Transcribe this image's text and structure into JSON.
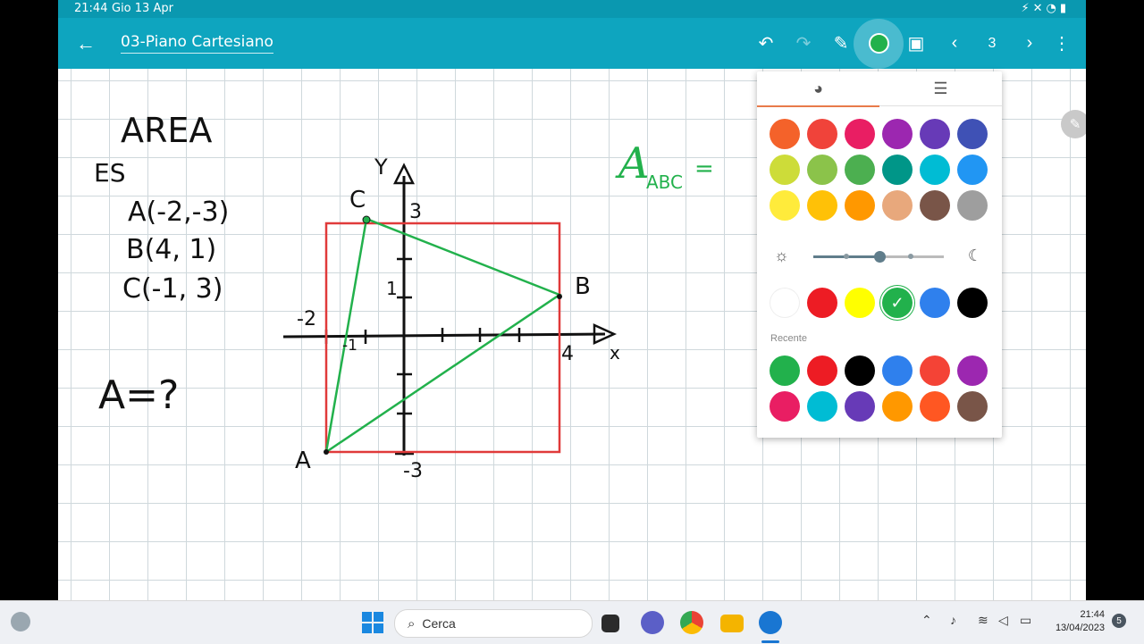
{
  "status_bar": {
    "time": "21:44",
    "date": "Gio 13 Apr",
    "system_icons": "⚡✕◔▮"
  },
  "app_bar": {
    "back_icon": "←",
    "title": "03-Piano Cartesiano",
    "undo_icon": "↶",
    "redo_icon": "↷",
    "pen_icon": "✎",
    "image_icon": "▣",
    "prev_icon": "‹",
    "page": "3",
    "next_icon": "›",
    "more_icon": "⋮",
    "active_color": "#22b14c"
  },
  "notes": {
    "heading": "AREA",
    "example_label": "ES",
    "points": [
      "A(-2,-3)",
      "B(4, 1)",
      "C(-1, 3)"
    ],
    "question": "A=?",
    "area_formula": "A",
    "area_subscript": "ABC",
    "area_equals": "=",
    "axis_x": "x",
    "axis_y": "Y",
    "labels": {
      "A": "A",
      "B": "B",
      "C": "C",
      "x_neg2": "-2",
      "x_neg1": "-1",
      "x_4": "4",
      "y_3": "3",
      "y_1": "1",
      "y_neg3": "-3"
    }
  },
  "palette": {
    "tab_colors_icon": "palette-icon",
    "tab_settings_icon": "sliders-icon",
    "main_colors": [
      "#f4622a",
      "#f0433a",
      "#e91e63",
      "#9c27b0",
      "#673ab7",
      "#3f51b5",
      "#cddc39",
      "#8bc34a",
      "#4caf50",
      "#009688",
      "#00bcd4",
      "#2196f3",
      "#ffeb3b",
      "#ffc107",
      "#ff9800",
      "#e8a87c",
      "#795548",
      "#9e9e9e"
    ],
    "shade_colors": [
      "#ffffff",
      "#ed1c24",
      "#ffff00",
      "#22b14c",
      "#2f80ed",
      "#000000"
    ],
    "selected_shade": 3,
    "recent_label": "Recente",
    "recent_colors": [
      "#22b14c",
      "#ed1c24",
      "#000000",
      "#2f80ed",
      "#f44336",
      "#9c27b0",
      "#e91e63",
      "#00bcd4",
      "#673ab7",
      "#ff9800",
      "#ff5722",
      "#795548"
    ],
    "brightness_level": 0.5
  },
  "taskbar": {
    "search_placeholder": "Cerca",
    "clock_time": "21:44",
    "clock_date": "13/04/2023",
    "notification_count": "5"
  }
}
